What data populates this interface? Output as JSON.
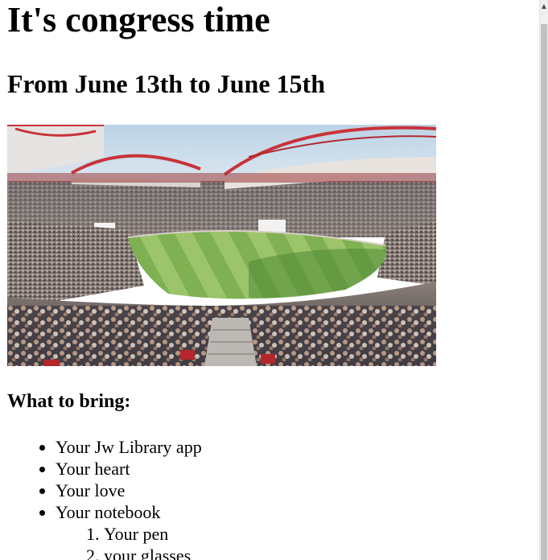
{
  "page": {
    "title": "It's congress time",
    "subtitle": "From June 13th to June 15th",
    "image": {
      "subject": "stadium-crowd-photo"
    },
    "section_heading": "What to bring:",
    "bring_items": [
      "Your Jw Library app",
      "Your heart",
      "Your love",
      "Your notebook"
    ],
    "notebook_subitems": [
      "Your pen",
      "your glasses"
    ]
  },
  "scrollbar": {
    "up_arrow_icon": "triangle-up-icon"
  },
  "colors": {
    "text": "#000000",
    "background": "#ffffff",
    "pitch_light": "#9cc46a",
    "pitch_dark": "#4f8a34",
    "roof": "#c8333a",
    "sky": "#c9dbe8"
  }
}
